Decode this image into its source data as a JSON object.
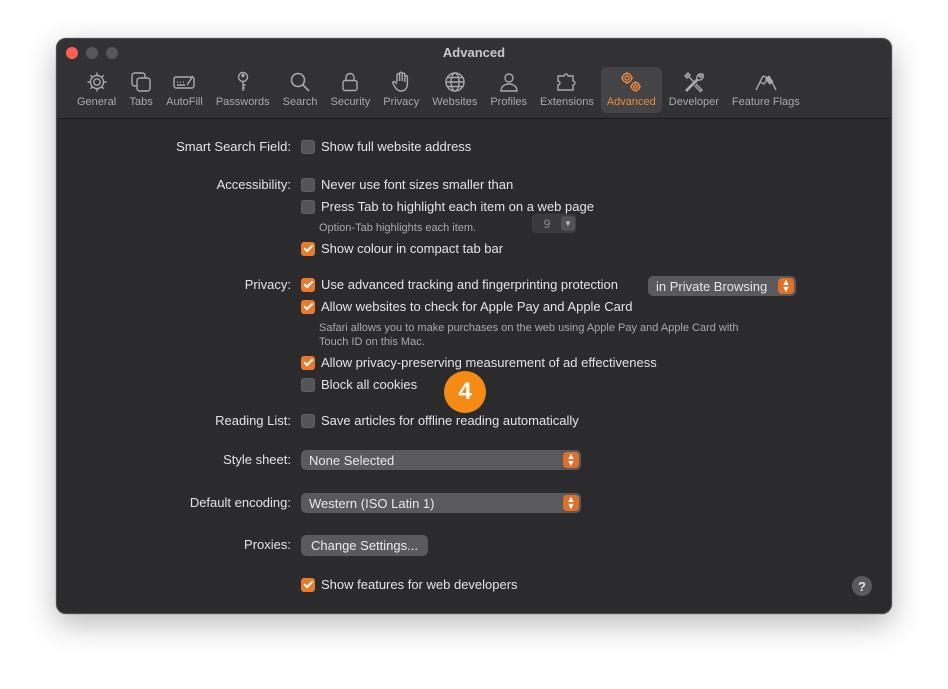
{
  "window": {
    "title": "Advanced"
  },
  "toolbar": {
    "items": [
      {
        "label": "General",
        "icon": "gear-icon"
      },
      {
        "label": "Tabs",
        "icon": "tabs-icon"
      },
      {
        "label": "AutoFill",
        "icon": "autofill-icon"
      },
      {
        "label": "Passwords",
        "icon": "key-icon"
      },
      {
        "label": "Search",
        "icon": "search-icon"
      },
      {
        "label": "Security",
        "icon": "lock-icon"
      },
      {
        "label": "Privacy",
        "icon": "hand-icon"
      },
      {
        "label": "Websites",
        "icon": "globe-icon"
      },
      {
        "label": "Profiles",
        "icon": "person-icon"
      },
      {
        "label": "Extensions",
        "icon": "puzzle-icon"
      },
      {
        "label": "Advanced",
        "icon": "gears-icon"
      },
      {
        "label": "Developer",
        "icon": "wrench-screwdriver-icon"
      },
      {
        "label": "Feature Flags",
        "icon": "flags-icon"
      }
    ],
    "active": "Advanced",
    "active_color": "#ef8a3c"
  },
  "smart_search": {
    "label": "Smart Search Field:",
    "show_full_address": {
      "text": "Show full website address",
      "checked": false
    }
  },
  "accessibility": {
    "label": "Accessibility:",
    "min_font": {
      "text": "Never use font sizes smaller than",
      "checked": false,
      "value": "9"
    },
    "press_tab": {
      "text": "Press Tab to highlight each item on a web page",
      "checked": false
    },
    "press_tab_hint": "Option-Tab highlights each item.",
    "compact_colour": {
      "text": "Show colour in compact tab bar",
      "checked": true
    }
  },
  "privacy": {
    "label": "Privacy:",
    "tracking": {
      "text": "Use advanced tracking and fingerprinting protection",
      "checked": true,
      "option": "in Private Browsing"
    },
    "apple_pay": {
      "text": "Allow websites to check for Apple Pay and Apple Card",
      "checked": true
    },
    "apple_pay_hint_line1": "Safari allows you to make purchases on the web using Apple Pay and Apple Card with",
    "apple_pay_hint_line2": "Touch ID on this Mac.",
    "ad_measurement": {
      "text": "Allow privacy-preserving measurement of ad effectiveness",
      "checked": true
    },
    "block_cookies": {
      "text": "Block all cookies",
      "checked": false
    }
  },
  "reading_list": {
    "label": "Reading List:",
    "offline": {
      "text": "Save articles for offline reading automatically",
      "checked": false
    }
  },
  "style_sheet": {
    "label": "Style sheet:",
    "value": "None Selected"
  },
  "encoding": {
    "label": "Default encoding:",
    "value": "Western (ISO Latin 1)"
  },
  "proxies": {
    "label": "Proxies:",
    "button": "Change Settings..."
  },
  "developer": {
    "show_features": {
      "text": "Show features for web developers",
      "checked": true
    }
  },
  "help": "?",
  "step_badge": "4",
  "colors": {
    "accent": "#ea7a2b",
    "badge": "#f58b12"
  }
}
